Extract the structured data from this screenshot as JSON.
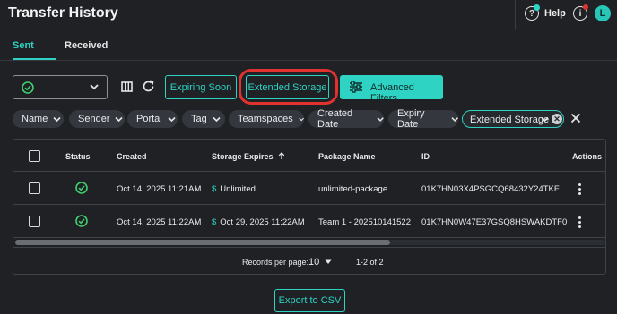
{
  "header": {
    "title": "Transfer History",
    "help_label": "Help",
    "help_icon": "question-circle-icon",
    "info_icon": "info-circle-icon",
    "avatar_initial": "L"
  },
  "tabs": [
    {
      "label": "Sent",
      "active": true
    },
    {
      "label": "Received",
      "active": false
    }
  ],
  "toolbar": {
    "status_select_icon": "check-circle-icon",
    "columns_icon": "columns-icon",
    "refresh_icon": "refresh-icon",
    "expiring_soon_label": "Expiring Soon",
    "extended_storage_label": "Extended Storage",
    "advanced_filters_label": "Advanced Filters"
  },
  "filters": {
    "chips": [
      {
        "label": "Name"
      },
      {
        "label": "Sender"
      },
      {
        "label": "Portal"
      },
      {
        "label": "Tag"
      },
      {
        "label": "Teamspaces"
      },
      {
        "label": "Created Date"
      },
      {
        "label": "Expiry Date"
      }
    ],
    "active_chip_label": "Extended Storage"
  },
  "table": {
    "columns": {
      "status": "Status",
      "created": "Created",
      "storage_expires": "Storage Expires",
      "package_name": "Package Name",
      "id": "ID",
      "actions": "Actions"
    },
    "sort": {
      "column": "storage_expires",
      "direction": "ascending"
    },
    "rows": [
      {
        "status": "success",
        "created": "Oct 14, 2025 11:21AM",
        "storage_expires": "Unlimited",
        "package_name": "unlimited-package",
        "id": "01K7HN03X4PSGCQ68432Y24TKF"
      },
      {
        "status": "success",
        "created": "Oct 14, 2025 11:22AM",
        "storage_expires": "Oct 29, 2025 11:22AM",
        "package_name": "Team 1 - 202510141522",
        "id": "01K7HN0W47E37GSQ8HSWAKDTF0"
      }
    ],
    "records_per_page_label": "Records per page:",
    "records_per_page_value": "10",
    "range_label": "1-2 of 2"
  },
  "export_label": "Export to CSV",
  "colors": {
    "accent": "#2ed3c3",
    "background": "#1f2125",
    "highlight": "#e0322e",
    "notification": "#e0322e"
  }
}
